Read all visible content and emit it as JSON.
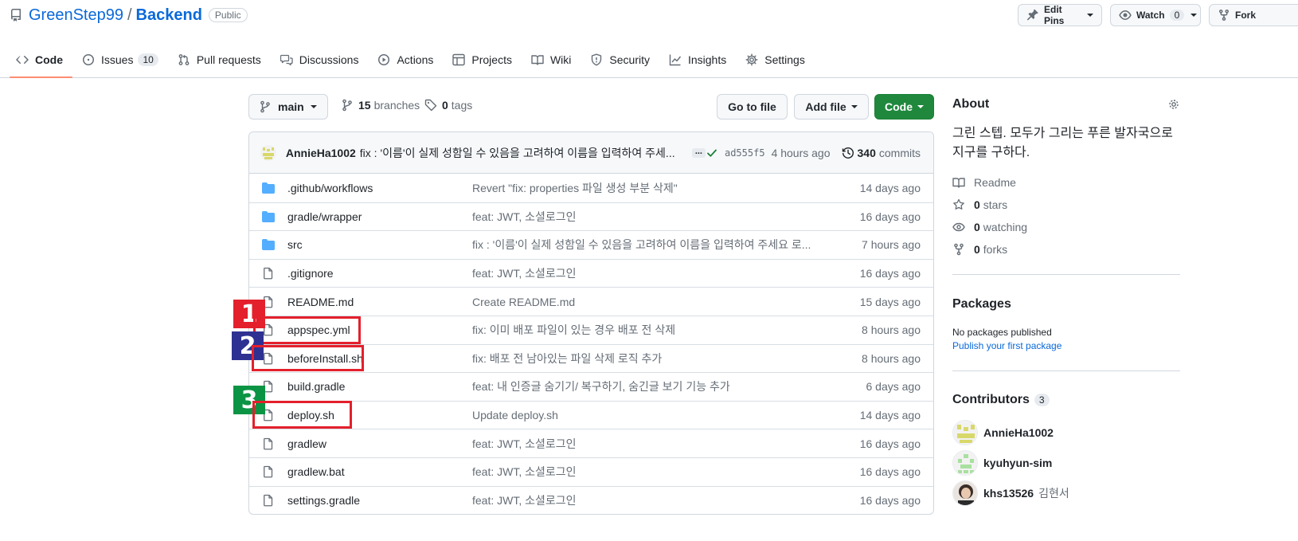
{
  "repo": {
    "owner": "GreenStep99",
    "separator": "/",
    "name": "Backend",
    "visibility": "Public"
  },
  "header_buttons": {
    "edit_pins": "Edit Pins",
    "watch": "Watch",
    "watch_count": "0",
    "fork": "Fork"
  },
  "tabs": [
    {
      "label": "Code",
      "icon": "code-icon"
    },
    {
      "label": "Issues",
      "icon": "issue-icon",
      "counter": "10"
    },
    {
      "label": "Pull requests",
      "icon": "pull-request-icon"
    },
    {
      "label": "Discussions",
      "icon": "discussion-icon"
    },
    {
      "label": "Actions",
      "icon": "play-icon"
    },
    {
      "label": "Projects",
      "icon": "table-icon"
    },
    {
      "label": "Wiki",
      "icon": "book-icon"
    },
    {
      "label": "Security",
      "icon": "shield-icon"
    },
    {
      "label": "Insights",
      "icon": "graph-icon"
    },
    {
      "label": "Settings",
      "icon": "gear-icon"
    }
  ],
  "toolbar": {
    "branch": "main",
    "branches_count": "15",
    "branches_label": "branches",
    "tags_count": "0",
    "tags_label": "tags",
    "go_to_file": "Go to file",
    "add_file": "Add file",
    "code": "Code"
  },
  "latest_commit": {
    "author": "AnnieHa1002",
    "message": "fix : '이름'이 실제 성함일 수 있음을 고려하여 이름을 입력하여 주세...",
    "ellipsis": "...",
    "sha": "ad555f5",
    "age": "4 hours ago",
    "commits_count": "340",
    "commits_label": "commits"
  },
  "files": [
    {
      "type": "dir",
      "name": ".github/workflows",
      "message": "Revert \"fix: properties 파일 생성 부분 삭제\"",
      "age": "14 days ago"
    },
    {
      "type": "dir",
      "name": "gradle/wrapper",
      "message": "feat: JWT, 소셜로그인",
      "age": "16 days ago"
    },
    {
      "type": "dir",
      "name": "src",
      "message": "fix : '이름'이 실제 성함일 수 있음을 고려하여 이름을 입력하여 주세요 로...",
      "age": "7 hours ago"
    },
    {
      "type": "file",
      "name": ".gitignore",
      "message": "feat: JWT, 소셜로그인",
      "age": "16 days ago"
    },
    {
      "type": "file",
      "name": "README.md",
      "message": "Create README.md",
      "age": "15 days ago"
    },
    {
      "type": "file",
      "name": "appspec.yml",
      "message": "fix: 이미 배포 파일이 있는 경우 배포 전 삭제",
      "age": "8 hours ago"
    },
    {
      "type": "file",
      "name": "beforeInstall.sh",
      "message": "fix: 배포 전 남아있는 파일 삭제 로직 추가",
      "age": "8 hours ago"
    },
    {
      "type": "file",
      "name": "build.gradle",
      "message": "feat: 내 인증글 숨기기/ 복구하기, 숨긴글 보기 기능 추가",
      "age": "6 days ago"
    },
    {
      "type": "file",
      "name": "deploy.sh",
      "message": "Update deploy.sh",
      "age": "14 days ago"
    },
    {
      "type": "file",
      "name": "gradlew",
      "message": "feat: JWT, 소셜로그인",
      "age": "16 days ago"
    },
    {
      "type": "file",
      "name": "gradlew.bat",
      "message": "feat: JWT, 소셜로그인",
      "age": "16 days ago"
    },
    {
      "type": "file",
      "name": "settings.gradle",
      "message": "feat: JWT, 소셜로그인",
      "age": "16 days ago"
    }
  ],
  "annotations": [
    {
      "number": "1",
      "color": "#e3202c"
    },
    {
      "number": "2",
      "color": "#2e3192"
    },
    {
      "number": "3",
      "color": "#0b9444"
    }
  ],
  "about": {
    "title": "About",
    "description": "그린 스텝. 모두가 그리는 푸른 발자국으로 지구를 구하다.",
    "readme": "Readme",
    "stars_count": "0",
    "stars_label": "stars",
    "watching_count": "0",
    "watching_label": "watching",
    "forks_count": "0",
    "forks_label": "forks"
  },
  "packages": {
    "title": "Packages",
    "none": "No packages published",
    "publish_link": "Publish your first package"
  },
  "contributors": {
    "title": "Contributors",
    "count": "3",
    "people": [
      {
        "login": "AnnieHa1002",
        "name": ""
      },
      {
        "login": "kyuhyun-sim",
        "name": ""
      },
      {
        "login": "khs13526",
        "name": "김현서"
      }
    ]
  },
  "colors": {
    "link": "#0969da",
    "green_button": "#1f883d",
    "folder": "#54aeff",
    "tab_underline": "#fd8c73"
  }
}
